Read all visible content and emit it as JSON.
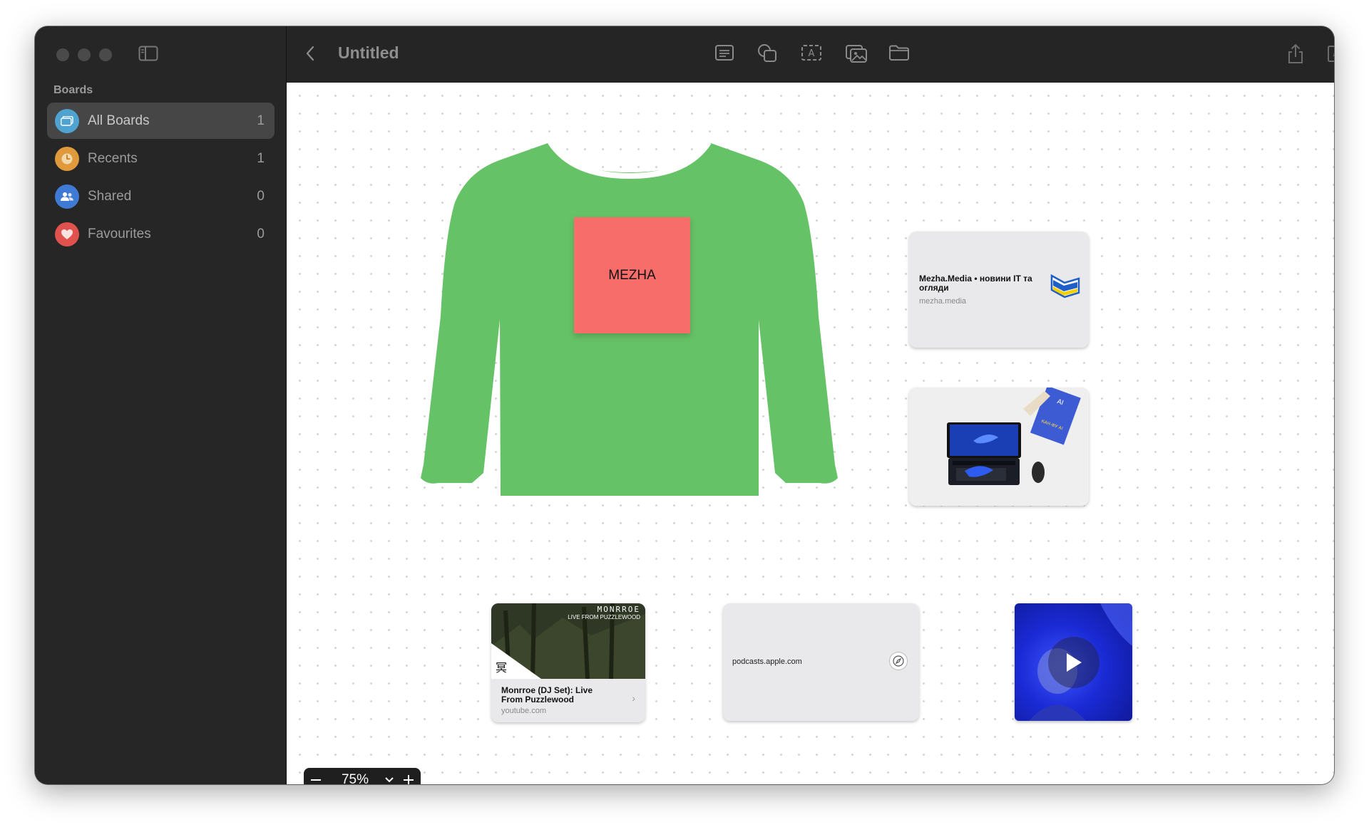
{
  "window": {
    "title": "Untitled"
  },
  "sidebar": {
    "section_label": "Boards",
    "items": [
      {
        "label": "All Boards",
        "count": "1",
        "icon": "boards-icon",
        "color": "#4fa3d1"
      },
      {
        "label": "Recents",
        "count": "1",
        "icon": "clock-icon",
        "color": "#e09a3b"
      },
      {
        "label": "Shared",
        "count": "0",
        "icon": "people-icon",
        "color": "#3f7bd4"
      },
      {
        "label": "Favourites",
        "count": "0",
        "icon": "heart-icon",
        "color": "#e0524d"
      }
    ]
  },
  "toolbar": {
    "tools": [
      "note-icon",
      "shapes-icon",
      "text-box-icon",
      "media-icon",
      "folder-icon"
    ],
    "actions": [
      "share-icon",
      "compose-icon"
    ]
  },
  "canvas": {
    "sticky_note": {
      "text": "MEZHA",
      "color": "#f66d69"
    },
    "shirt_color": "#66c266",
    "link_card_1": {
      "title": "Mezha.Media • новини IT та огляди",
      "domain": "mezha.media"
    },
    "link_card_youtube": {
      "title": "Monrroe (DJ Set): Live From Puzzlewood",
      "domain": "youtube.com",
      "thumb_brand": "MONRROE",
      "thumb_subtitle": "LIVE FROM PUZZLEWOOD"
    },
    "link_card_podcasts": {
      "domain": "podcasts.apple.com"
    },
    "book_caption": "AI НАДАРНИЙ ШТУЧНИЙ ІНТЕЛЕКТ КАН-ФУ АІ",
    "zoom": {
      "value": "75%"
    }
  }
}
